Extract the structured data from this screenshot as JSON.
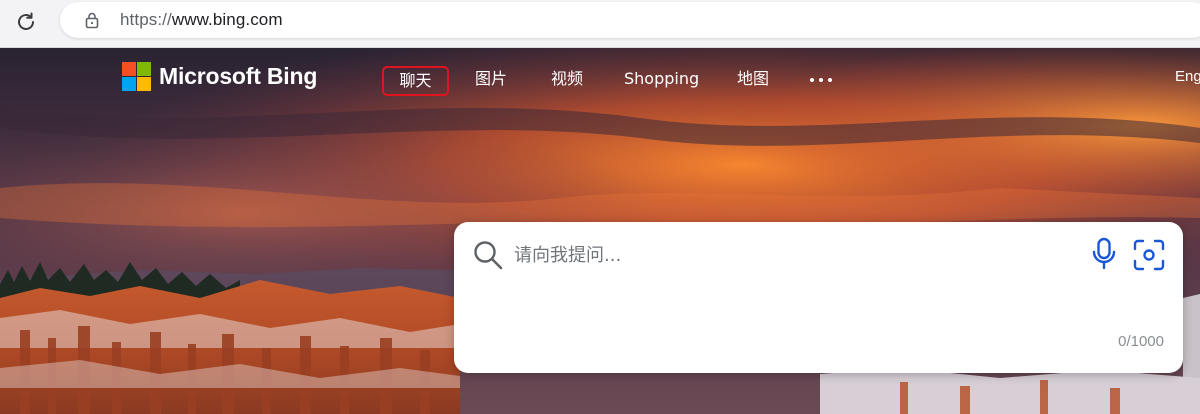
{
  "browser": {
    "url_scheme": "https://",
    "url_host": "www.bing.com",
    "reload_icon": "reload-icon",
    "lock_icon": "lock-icon"
  },
  "logo": {
    "text": "Microsoft Bing",
    "colors": [
      "#f25022",
      "#7fba00",
      "#00a4ef",
      "#ffb900"
    ]
  },
  "nav": {
    "items": [
      {
        "label": "聊天",
        "selected": true
      },
      {
        "label": "图片"
      },
      {
        "label": "视频"
      },
      {
        "label": "Shopping"
      },
      {
        "label": "地图"
      }
    ],
    "more_icon": "more-dots-icon",
    "highlight_color": "#e0141e"
  },
  "lang": {
    "label": "Eng"
  },
  "search": {
    "placeholder": "请向我提问...",
    "value": "",
    "char_count": "0/1000",
    "accent_color": "#1a57d6"
  }
}
